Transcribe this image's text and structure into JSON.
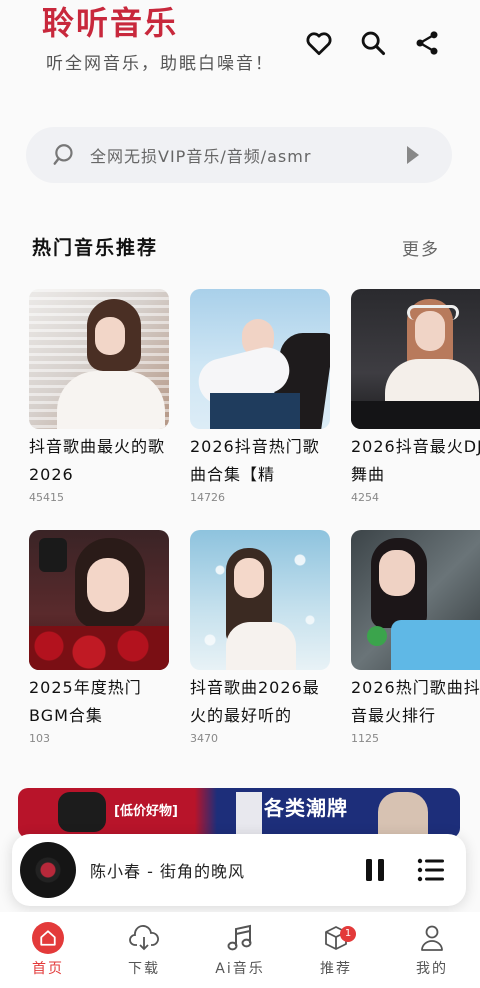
{
  "header": {
    "title": "聆听音乐",
    "subtitle": "听全网音乐，助眠白噪音！",
    "icons": [
      "heart-icon",
      "search-icon",
      "share-icon"
    ]
  },
  "search": {
    "placeholder": "全网无损VIP音乐/音频/asmr"
  },
  "section": {
    "title": "热门音乐推荐",
    "more": "更多"
  },
  "playlists": [
    {
      "title": "抖音歌曲最火的歌2026",
      "count": "45415"
    },
    {
      "title": "2026抖音热门歌曲合集【精",
      "count": "14726"
    },
    {
      "title": "2026抖音最火DJ舞曲",
      "count": "4254"
    },
    {
      "title": "2025年度热门BGM合集",
      "count": "103"
    },
    {
      "title": "抖音歌曲2026最火的最好听的",
      "count": "3470"
    },
    {
      "title": "2026热门歌曲抖音最火排行",
      "count": "1125"
    }
  ],
  "banner": {
    "tag": "[低价好物]",
    "text": "各类潮牌"
  },
  "player": {
    "track": "陈小春 - 街角的晚风"
  },
  "tabs": [
    {
      "label": "首页",
      "active": true
    },
    {
      "label": "下载"
    },
    {
      "label": "Ai音乐"
    },
    {
      "label": "推荐",
      "badge": "1"
    },
    {
      "label": "我的"
    }
  ],
  "colors": {
    "brand": "#c8283c",
    "active_tab": "#e33a3a"
  }
}
